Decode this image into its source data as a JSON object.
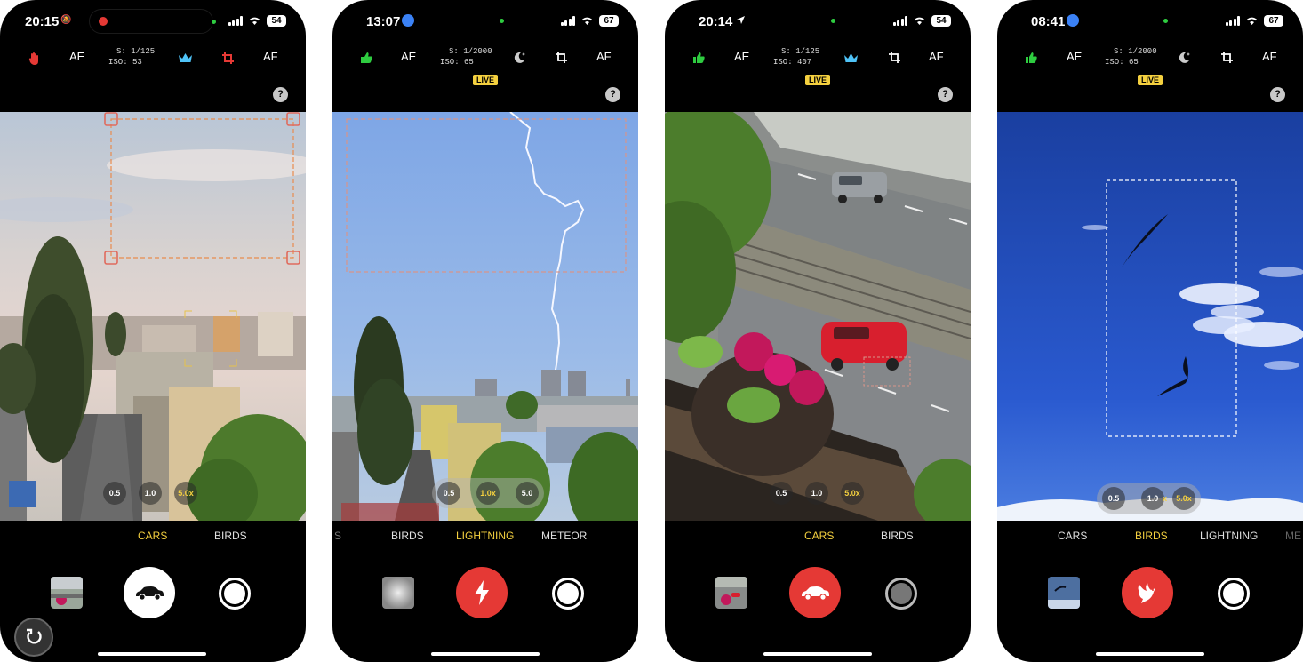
{
  "phones": [
    {
      "time": "20:15",
      "battery": "54",
      "toolbar": {
        "ae": "AE",
        "af": "AF",
        "shutter_speed": "S: 1/125",
        "iso": "ISO: 53"
      },
      "zoom": [
        "0.5",
        "1.0",
        "5.0x"
      ],
      "active_zoom": "5.0x",
      "modes": [
        "CARS",
        "BIRDS"
      ],
      "active_mode": "CARS",
      "shutter_icon": "car-icon",
      "help": "?"
    },
    {
      "time": "13:07",
      "battery": "67",
      "toolbar": {
        "ae": "AE",
        "af": "AF",
        "shutter_speed": "S: 1/2000",
        "iso": "ISO: 65"
      },
      "live": "LIVE",
      "zoom": [
        "0.5",
        "1.0x",
        "5.0"
      ],
      "active_zoom": "1.0x",
      "modes": [
        "S",
        "BIRDS",
        "LIGHTNING",
        "METEOR"
      ],
      "active_mode": "LIGHTNING",
      "shutter_icon": "lightning-icon",
      "help": "?"
    },
    {
      "time": "20:14",
      "battery": "54",
      "toolbar": {
        "ae": "AE",
        "af": "AF",
        "shutter_speed": "S: 1/125",
        "iso": "ISO: 407"
      },
      "live": "LIVE",
      "zoom": [
        "0.5",
        "1.0",
        "5.0x"
      ],
      "active_zoom": "5.0x",
      "modes": [
        "CARS",
        "BIRDS"
      ],
      "active_mode": "CARS",
      "shutter_icon": "car-icon",
      "help": "?"
    },
    {
      "time": "08:41",
      "battery": "67",
      "toolbar": {
        "ae": "AE",
        "af": "AF",
        "shutter_speed": "S: 1/2000",
        "iso": "ISO: 65"
      },
      "live": "LIVE",
      "zoom": [
        "0.5",
        "1.0",
        "x",
        "5.0x"
      ],
      "active_zoom": "5.0x",
      "modes": [
        "CARS",
        "BIRDS",
        "LIGHTNING",
        "ME"
      ],
      "active_mode": "BIRDS",
      "shutter_icon": "bird-icon",
      "help": "?"
    }
  ],
  "colors": {
    "accent_yellow": "#f4d03f",
    "shutter_red": "#e53935",
    "thumb_up_green": "#2ecc40",
    "crown_blue": "#4fc3f7"
  }
}
